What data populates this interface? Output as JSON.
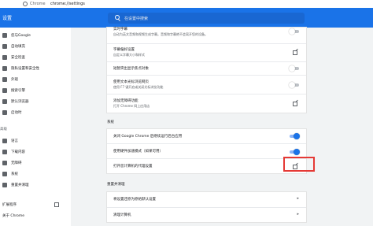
{
  "addressbar": {
    "app": "Chrome",
    "url": "chrome://settings"
  },
  "header": {
    "title": "设置",
    "search_placeholder": "在设置中搜索"
  },
  "sidebar": {
    "items": [
      {
        "label": "您与Google",
        "icon": "person-icon"
      },
      {
        "label": "自动填充",
        "icon": "autofill-icon"
      },
      {
        "label": "安全检查",
        "icon": "shield-icon"
      },
      {
        "label": "隐私设置和安全性",
        "icon": "lock-icon"
      },
      {
        "label": "外观",
        "icon": "palette-icon"
      },
      {
        "label": "搜索引擎",
        "icon": "search-icon"
      },
      {
        "label": "默认浏览器",
        "icon": "browser-icon"
      },
      {
        "label": "启动时",
        "icon": "power-icon"
      }
    ],
    "advanced_section": "高级",
    "advanced_items": [
      {
        "label": "语言",
        "icon": "globe-icon"
      },
      {
        "label": "下载内容",
        "icon": "download-icon"
      },
      {
        "label": "无障碍",
        "icon": "accessibility-icon"
      },
      {
        "label": "系统",
        "icon": "wrench-icon"
      },
      {
        "label": "重置并清理",
        "icon": "reset-icon"
      }
    ],
    "extensions": "扩展程序",
    "about": "关于 Chrome"
  },
  "accessibility_card": {
    "rows": [
      {
        "title": "实时字幕",
        "sub": "自动为英文音频和视频生成字幕。音频和字幕绝不会离开您的设备。"
      },
      {
        "title": "字幕偏好设置",
        "sub": "自定义字幕大小和样式"
      },
      {
        "title": "使用文本光标浏览网页",
        "sub": "使用 F7 键开启或关闭光标浏览功能"
      },
      {
        "title": "添加无障碍功能",
        "sub": "打开 Chrome 网上应用店"
      }
    ],
    "highlight_label": "短暂突出显示焦点对象"
  },
  "system": {
    "heading": "系统",
    "rows": [
      {
        "title": "关闭 Google Chrome 后继续运行后台应用",
        "on": true
      },
      {
        "title": "使用硬件加速模式（如果可用）",
        "on": true
      },
      {
        "title": "打开您计算机的代理设置"
      }
    ]
  },
  "reset": {
    "heading": "重置并清理",
    "rows": [
      {
        "title": "将设置还原为原始默认设置"
      },
      {
        "title": "清理计算机"
      }
    ]
  }
}
